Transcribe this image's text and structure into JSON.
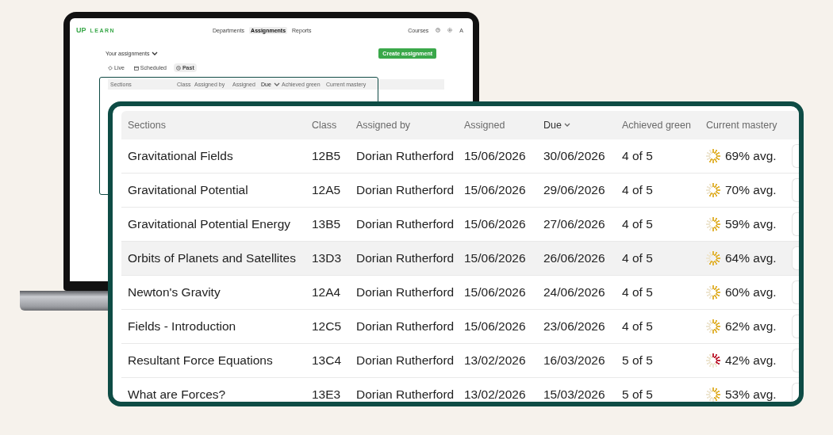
{
  "laptop": {
    "logo": {
      "mark": "UP",
      "word": "LEARN"
    },
    "nav": [
      {
        "label": "Departments",
        "selected": false
      },
      {
        "label": "Assignments",
        "selected": true
      },
      {
        "label": "Reports",
        "selected": false
      }
    ],
    "courses": "Courses",
    "avatar": "A",
    "view_select": "Your assignments",
    "create_button": "Create assignment",
    "tabs": [
      {
        "label": "Live",
        "kind": "live",
        "selected": false
      },
      {
        "label": "Scheduled",
        "kind": "scheduled",
        "selected": false
      },
      {
        "label": "Past",
        "kind": "past",
        "selected": true
      }
    ],
    "columns": [
      {
        "label": "Sections",
        "sorted": false
      },
      {
        "label": "Class",
        "sorted": false
      },
      {
        "label": "Assigned by",
        "sorted": false
      },
      {
        "label": "Assigned",
        "sorted": false
      },
      {
        "label": "Due",
        "sorted": true
      },
      {
        "label": "Achieved green",
        "sorted": false
      },
      {
        "label": "Current mastery",
        "sorted": false
      }
    ]
  },
  "panel": {
    "columns": [
      {
        "label": "Sections",
        "sorted": false
      },
      {
        "label": "Class",
        "sorted": false
      },
      {
        "label": "Assigned by",
        "sorted": false
      },
      {
        "label": "Assigned",
        "sorted": false
      },
      {
        "label": "Due",
        "sorted": true
      },
      {
        "label": "Achieved green",
        "sorted": false
      },
      {
        "label": "Current mastery",
        "sorted": false
      }
    ],
    "rows": [
      {
        "section": "Gravitational Fields",
        "class": "12B5",
        "assigned_by": "Dorian Rutherford",
        "assigned": "15/06/2026",
        "due": "30/06/2026",
        "achieved": "4 of 5",
        "mastery": "69% avg.",
        "level": 0.69,
        "color": "#e2b53a",
        "highlighted": false
      },
      {
        "section": "Gravitational Potential",
        "class": "12A5",
        "assigned_by": "Dorian Rutherford",
        "assigned": "15/06/2026",
        "due": "29/06/2026",
        "achieved": "4 of 5",
        "mastery": "70% avg.",
        "level": 0.7,
        "color": "#e2b53a",
        "highlighted": false
      },
      {
        "section": "Gravitational Potential Energy",
        "class": "13B5",
        "assigned_by": "Dorian Rutherford",
        "assigned": "15/06/2026",
        "due": "27/06/2026",
        "achieved": "4 of 5",
        "mastery": "59% avg.",
        "level": 0.59,
        "color": "#e2b53a",
        "highlighted": false
      },
      {
        "section": "Orbits of Planets and Satellites",
        "class": "13D3",
        "assigned_by": "Dorian Rutherford",
        "assigned": "15/06/2026",
        "due": "26/06/2026",
        "achieved": "4 of 5",
        "mastery": "64% avg.",
        "level": 0.64,
        "color": "#e2b53a",
        "highlighted": true
      },
      {
        "section": "Newton's Gravity",
        "class": "12A4",
        "assigned_by": "Dorian Rutherford",
        "assigned": "15/06/2026",
        "due": "24/06/2026",
        "achieved": "4 of 5",
        "mastery": "60% avg.",
        "level": 0.6,
        "color": "#e2b53a",
        "highlighted": false
      },
      {
        "section": "Fields - Introduction",
        "class": "12C5",
        "assigned_by": "Dorian Rutherford",
        "assigned": "15/06/2026",
        "due": "23/06/2026",
        "achieved": "4 of 5",
        "mastery": "62% avg.",
        "level": 0.62,
        "color": "#e2b53a",
        "highlighted": false
      },
      {
        "section": "Resultant Force Equations",
        "class": "13C4",
        "assigned_by": "Dorian Rutherford",
        "assigned": "13/02/2026",
        "due": "16/03/2026",
        "achieved": "5 of 5",
        "mastery": "42% avg.",
        "level": 0.42,
        "color": "#c0283a",
        "highlighted": false
      },
      {
        "section": "What are Forces?",
        "class": "13E3",
        "assigned_by": "Dorian Rutherford",
        "assigned": "13/02/2026",
        "due": "15/03/2026",
        "achieved": "5 of 5",
        "mastery": "53% avg.",
        "level": 0.53,
        "color": "#e2b53a",
        "highlighted": false
      }
    ]
  }
}
